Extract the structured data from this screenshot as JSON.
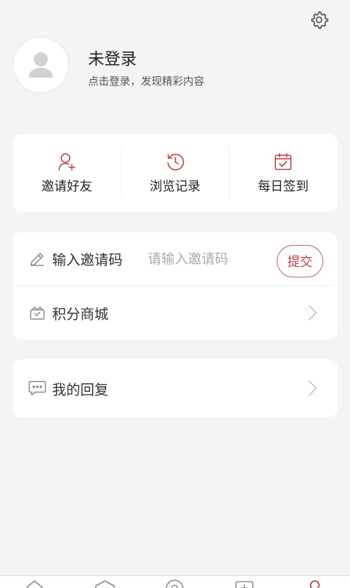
{
  "profile": {
    "title": "未登录",
    "subtitle": "点击登录，发现精彩内容"
  },
  "quick_actions": [
    {
      "label": "邀请好友",
      "icon": "add-user-icon"
    },
    {
      "label": "浏览记录",
      "icon": "history-icon"
    },
    {
      "label": "每日签到",
      "icon": "calendar-check-icon"
    }
  ],
  "invite": {
    "label": "输入邀请码",
    "placeholder": "请输入邀请码",
    "submit_label": "提交",
    "icon": "pencil-icon"
  },
  "points_mall": {
    "label": "积分商城",
    "icon": "gift-box-icon"
  },
  "my_replies": {
    "label": "我的回复",
    "icon": "chat-bubble-icon"
  },
  "tabbar": {
    "tabs": [
      {
        "icon": "home-icon"
      },
      {
        "icon": "category-icon"
      },
      {
        "icon": "location-icon"
      },
      {
        "icon": "plus-square-icon"
      },
      {
        "icon": "profile-icon",
        "active": true
      }
    ]
  },
  "colors": {
    "accent": "#b8423e",
    "background": "#f4f4f4",
    "card": "#ffffff"
  }
}
